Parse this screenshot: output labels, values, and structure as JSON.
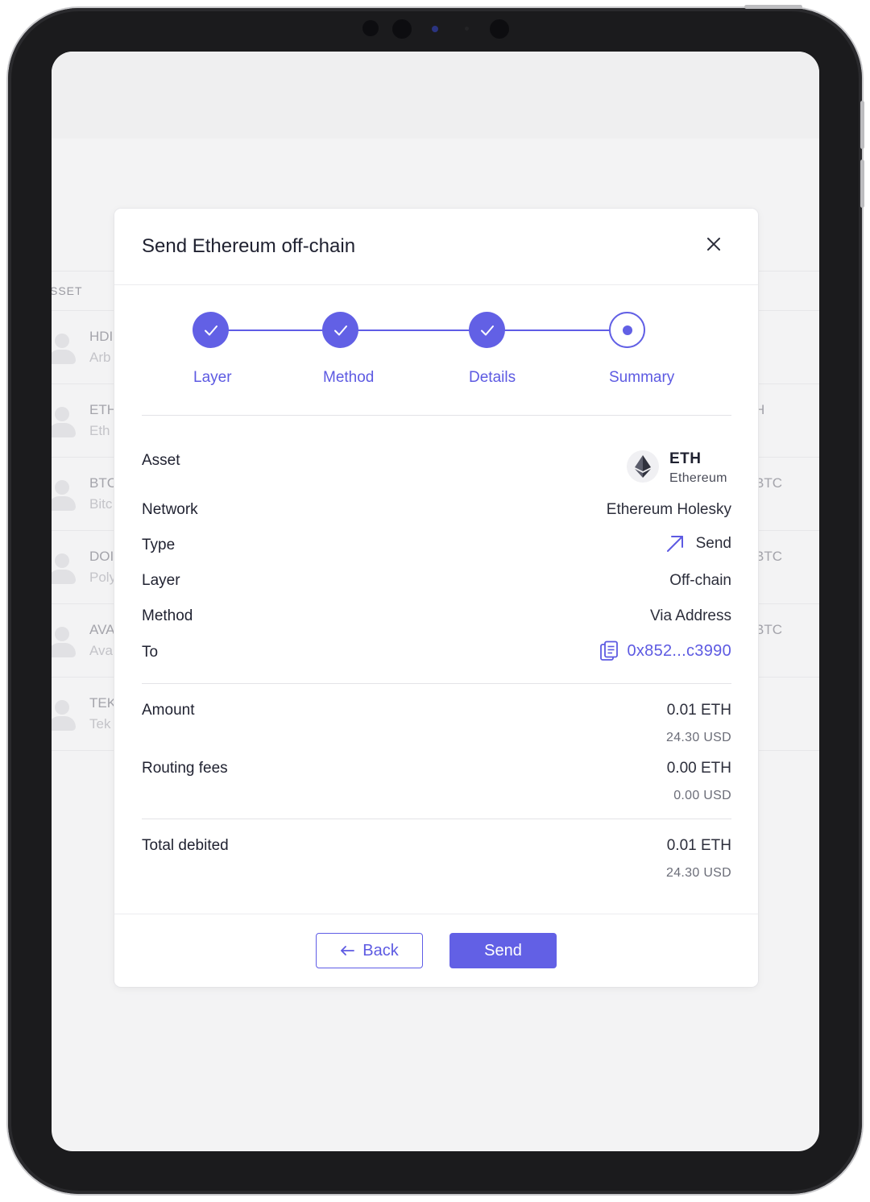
{
  "background": {
    "table_header": {
      "asset_col": "SSET",
      "right_col": "↓"
    },
    "rows": [
      {
        "symbol": "HDI",
        "name": "Arb",
        "right": ""
      },
      {
        "symbol": "ETH",
        "name": "Eth",
        "right": "H"
      },
      {
        "symbol": "BTC",
        "name": "Bitc",
        "right": "BTC"
      },
      {
        "symbol": "DOI",
        "name": "Poly",
        "right": "BTC"
      },
      {
        "symbol": "AVA",
        "name": "Ava",
        "right": "BTC"
      },
      {
        "symbol": "TEK",
        "name": "Tek",
        "right": ""
      }
    ]
  },
  "modal": {
    "title": "Send Ethereum off-chain",
    "close_icon": "close-icon",
    "steps": [
      {
        "label": "Layer",
        "state": "done"
      },
      {
        "label": "Method",
        "state": "done"
      },
      {
        "label": "Details",
        "state": "done"
      },
      {
        "label": "Summary",
        "state": "current"
      }
    ],
    "summary": {
      "asset_label": "Asset",
      "asset_symbol": "ETH",
      "asset_name": "Ethereum",
      "network_label": "Network",
      "network_value": "Ethereum Holesky",
      "type_label": "Type",
      "type_value": "Send",
      "layer_label": "Layer",
      "layer_value": "Off-chain",
      "method_label": "Method",
      "method_value": "Via Address",
      "to_label": "To",
      "to_value": "0x852...c3990"
    },
    "amounts": {
      "amount_label": "Amount",
      "amount_value": "0.01 ETH",
      "amount_usd": "24.30 USD",
      "fees_label": "Routing fees",
      "fees_value": "0.00 ETH",
      "fees_usd": "0.00 USD",
      "total_label": "Total debited",
      "total_value": "0.01 ETH",
      "total_usd": "24.30 USD"
    },
    "footer": {
      "back_label": "Back",
      "send_label": "Send"
    }
  },
  "colors": {
    "accent": "#6260e5",
    "text": "#1f2130",
    "muted": "#6b6d78"
  }
}
